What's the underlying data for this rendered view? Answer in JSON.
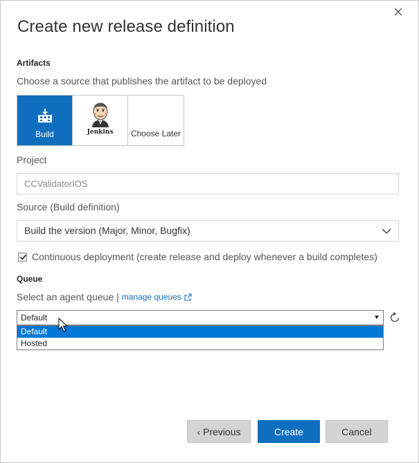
{
  "dialog": {
    "title": "Create new release definition",
    "close_icon": "close-icon"
  },
  "artifacts": {
    "heading": "Artifacts",
    "hint": "Choose a source that publishes the artifact to be deployed",
    "sources": [
      {
        "label": "Build",
        "icon": "build-icon",
        "selected": true
      },
      {
        "label": "Jenkins",
        "icon": "jenkins-icon",
        "selected": false
      },
      {
        "label": "Choose Later",
        "icon": "",
        "selected": false
      }
    ]
  },
  "project": {
    "label": "Project",
    "value": "CCValidatorIOS"
  },
  "source": {
    "label": "Source (Build definition)",
    "value": "Build the version (Major, Minor, Bugfix)",
    "icon": "chevron-down-icon"
  },
  "continuous_deployment": {
    "checked": true,
    "label": "Continuous deployment (create release and deploy whenever a build completes)"
  },
  "queue": {
    "heading": "Queue",
    "hint": "Select an agent queue",
    "separator": "|",
    "manage_link": "manage queues",
    "selected": "Default",
    "options": [
      "Default",
      "Hosted"
    ],
    "highlighted_option": "Default",
    "refresh_icon": "refresh-icon"
  },
  "footer": {
    "previous_label": "‹ Previous",
    "create_label": "Create",
    "cancel_label": "Cancel"
  },
  "colors": {
    "accent": "#106ebe",
    "highlight": "#0078d7",
    "button_gray": "#d4d4d4"
  }
}
